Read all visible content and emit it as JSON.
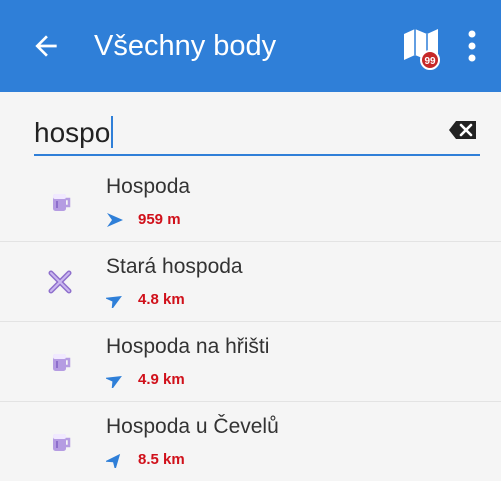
{
  "appbar": {
    "title": "Všechny body",
    "back_icon": "arrow-left-icon",
    "map_icon": "map-with-count-badge-icon",
    "map_badge": "99",
    "more_icon": "more-vertical-icon",
    "color": "#2f7fd8"
  },
  "search": {
    "value": "hospo",
    "clear_icon": "backspace-clear-icon"
  },
  "results": [
    {
      "name": "Hospoda",
      "distance": "959 m",
      "icon": "beer-mug-icon",
      "direction_deg": 90
    },
    {
      "name": "Stará hospoda",
      "distance": "4.8 km",
      "icon": "crossed-tools-icon",
      "direction_deg": 60
    },
    {
      "name": "Hospoda na hřišti",
      "distance": "4.9 km",
      "icon": "beer-mug-icon",
      "direction_deg": 60
    },
    {
      "name": "Hospoda u Čevelů",
      "distance": "8.5 km",
      "icon": "beer-mug-icon",
      "direction_deg": 40
    }
  ]
}
